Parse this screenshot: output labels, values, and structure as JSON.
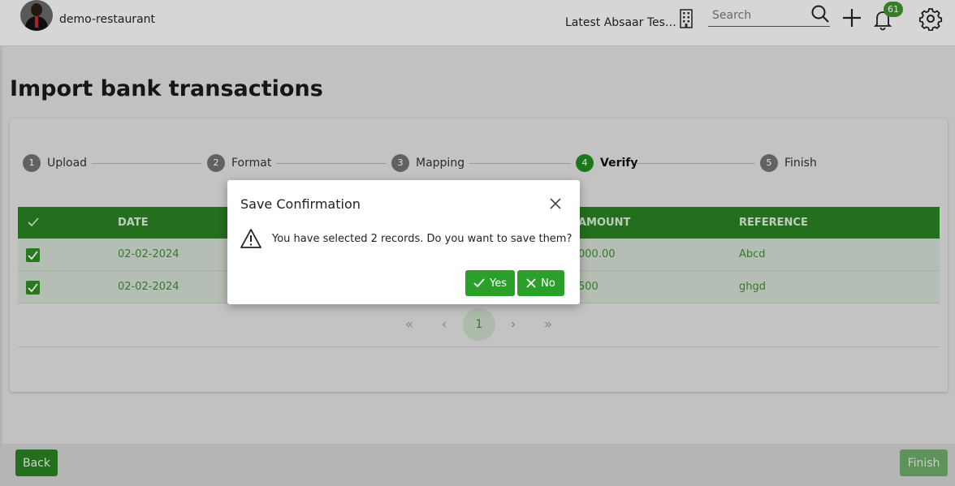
{
  "header": {
    "company": "demo-restaurant",
    "organization": "Latest Absaar Testing",
    "search_placeholder": "Search",
    "notification_count": "61"
  },
  "page": {
    "title": "Import bank transactions"
  },
  "steps": [
    {
      "num": "1",
      "label": "Upload"
    },
    {
      "num": "2",
      "label": "Format"
    },
    {
      "num": "3",
      "label": "Mapping"
    },
    {
      "num": "4",
      "label": "Verify",
      "active": true
    },
    {
      "num": "5",
      "label": "Finish"
    }
  ],
  "table": {
    "columns": [
      "DATE",
      "AMOUNT",
      "REFERENCE"
    ],
    "rows": [
      {
        "date": "02-02-2024",
        "amount": "000.00",
        "reference": "Abcd"
      },
      {
        "date": "02-02-2024",
        "amount": "500",
        "reference": "ghgd"
      }
    ]
  },
  "pagination": {
    "first": "«",
    "prev": "‹",
    "current": "1",
    "next": "›",
    "last": "»"
  },
  "footer": {
    "back_label": "Back",
    "finish_label": "Finish"
  },
  "modal": {
    "title": "Save Confirmation",
    "message": "You have selected 2 records. Do you want to save them?",
    "yes_label": "Yes",
    "no_label": "No"
  },
  "colors": {
    "accent": "#2a7f22",
    "button": "#2aa02a"
  }
}
